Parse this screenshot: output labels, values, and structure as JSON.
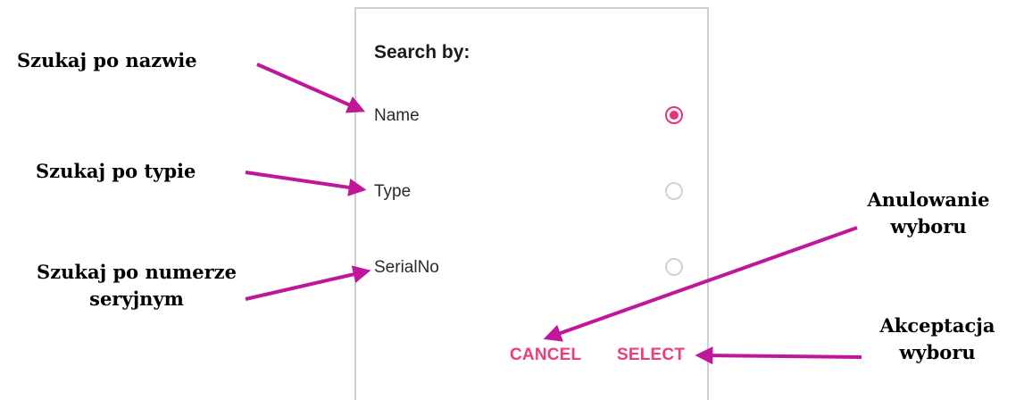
{
  "dialog": {
    "title": "Search by:",
    "options": [
      {
        "label": "Name",
        "selected": true
      },
      {
        "label": "Type",
        "selected": false
      },
      {
        "label": "SerialNo",
        "selected": false
      }
    ],
    "cancel_label": "CANCEL",
    "select_label": "SELECT",
    "accent_color": "#e8317a"
  },
  "annotations": {
    "name": "Szukaj po nazwie",
    "type": "Szukaj po typie",
    "serial_line1": "Szukaj po numerze",
    "serial_line2": "seryjnym",
    "cancel_line1": "Anulowanie",
    "cancel_line2": "wyboru",
    "select_line1": "Akceptacja",
    "select_line2": "wyboru",
    "arrow_color": "#c0169a"
  }
}
